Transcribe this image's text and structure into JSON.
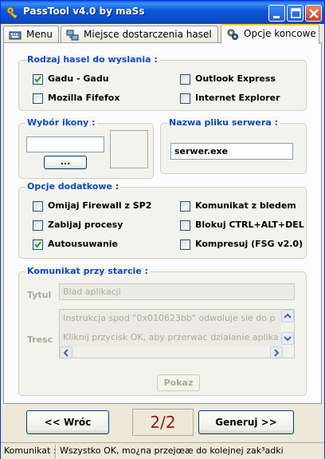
{
  "window": {
    "title": "PassTool v4.0 by maSs"
  },
  "tabs": [
    {
      "label": "Menu",
      "icon": "keyboard-icon"
    },
    {
      "label": "Miejsce dostarczenia hasel",
      "icon": "network-icon"
    },
    {
      "label": "Opcje koncowe",
      "icon": "gears-icon",
      "active": true
    }
  ],
  "groups": {
    "hash_types": {
      "title": "Rodzaj hasel do wyslania :",
      "items": [
        {
          "label": "Gadu - Gadu",
          "checked": true
        },
        {
          "label": "Outlook Express",
          "checked": false
        },
        {
          "label": "Mozilla Fifefox",
          "checked": false
        },
        {
          "label": "Internet Explorer",
          "checked": false
        }
      ]
    },
    "icon_choice": {
      "title": "Wybór ikony :",
      "browse_label": "..."
    },
    "server_file": {
      "title": "Nazwa pliku serwera :",
      "value": "serwer.exe"
    },
    "extra": {
      "title": "Opcje dodatkowe :",
      "items": [
        {
          "label": "Omijaj Firewall z SP2",
          "checked": false
        },
        {
          "label": "Komunikat z bledem",
          "checked": false
        },
        {
          "label": "Zabijaj procesy",
          "checked": false
        },
        {
          "label": "Blokuj CTRL+ALT+DEL",
          "checked": false
        },
        {
          "label": "Autousuwanie",
          "checked": true
        },
        {
          "label": "Kompresuj (FSG v2.0)",
          "checked": false
        }
      ]
    },
    "startup_msg": {
      "title": "Komunikat przy starcie :",
      "title_label": "Tytul",
      "title_value": "Blad aplikacji",
      "body_label": "Tresc",
      "body_lines": [
        "Instrukcja spod \"0x010623bb\" odwoluje sie do p",
        "Kliknij przycisk OK, aby przerwac dzialanie aplika"
      ],
      "show_label": "Pokaz"
    }
  },
  "nav": {
    "back_label": "<< Wróc",
    "page_indicator": "2/2",
    "next_label": "Generuj >>"
  },
  "status": {
    "label": "Komunikat :",
    "message": "Wszystko OK, mo¿na przejœæ do kolejnej zak³adki"
  }
}
